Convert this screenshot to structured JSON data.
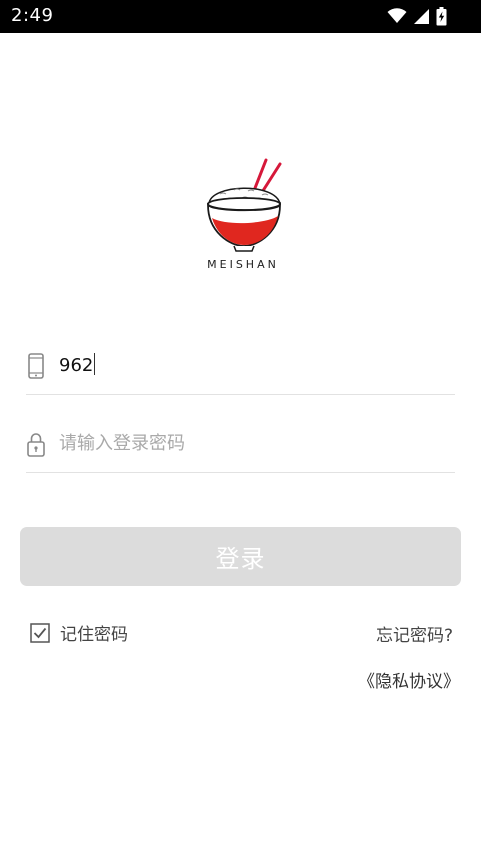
{
  "status_bar": {
    "time": "2:49",
    "icons": [
      "wifi-icon",
      "signal-icon",
      "battery-charging-icon"
    ]
  },
  "logo": {
    "brand_text": "MEISHAN",
    "colors": {
      "bowl_red": "#e0271f",
      "chopsticks": "#d6183a",
      "outline": "#1a1a1a"
    }
  },
  "form": {
    "phone": {
      "icon": "phone-icon",
      "value": "962"
    },
    "password": {
      "icon": "lock-icon",
      "placeholder": "请输入登录密码"
    },
    "login_button_label": "登录",
    "remember": {
      "label": "记住密码",
      "checked": true
    },
    "forgot_label": "忘记密码?",
    "privacy_label": "《隐私协议》"
  },
  "colors": {
    "button_bg": "#dcdcdc",
    "divider": "#e2e2e2",
    "placeholder": "#a9a9a9"
  }
}
